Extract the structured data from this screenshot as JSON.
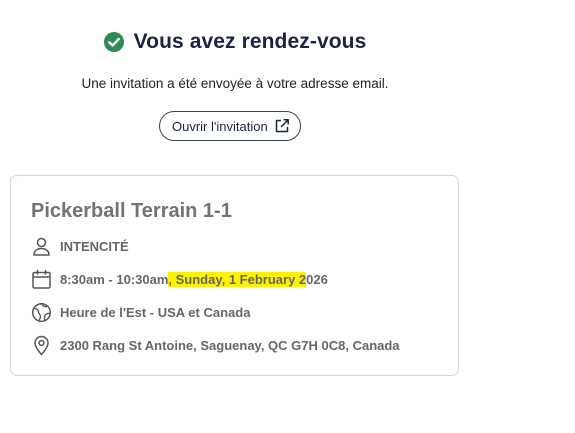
{
  "header": {
    "title": "Vous avez rendez-vous",
    "subtitle": "Une invitation a été envoyée à votre adresse email.",
    "open_button_label": "Ouvrir l'invitation",
    "success_color": "#2e8b57"
  },
  "card": {
    "title": "Pickerball Terrain 1-1",
    "organizer": "INTENCITÉ",
    "time_range": "8:30am - 10:30am",
    "date_highlighted": ", Sunday, 1 February 2",
    "date_rest": "026",
    "timezone": "Heure de l'Est - USA et Canada",
    "location": "2300 Rang St Antoine, Saguenay, QC G7H 0C8, Canada",
    "highlight_color": "#fff200"
  },
  "icons": {
    "success": "check-circle-icon",
    "external": "external-link-icon",
    "organizer": "user-icon",
    "date": "calendar-icon",
    "timezone": "globe-icon",
    "location": "map-pin-icon"
  }
}
